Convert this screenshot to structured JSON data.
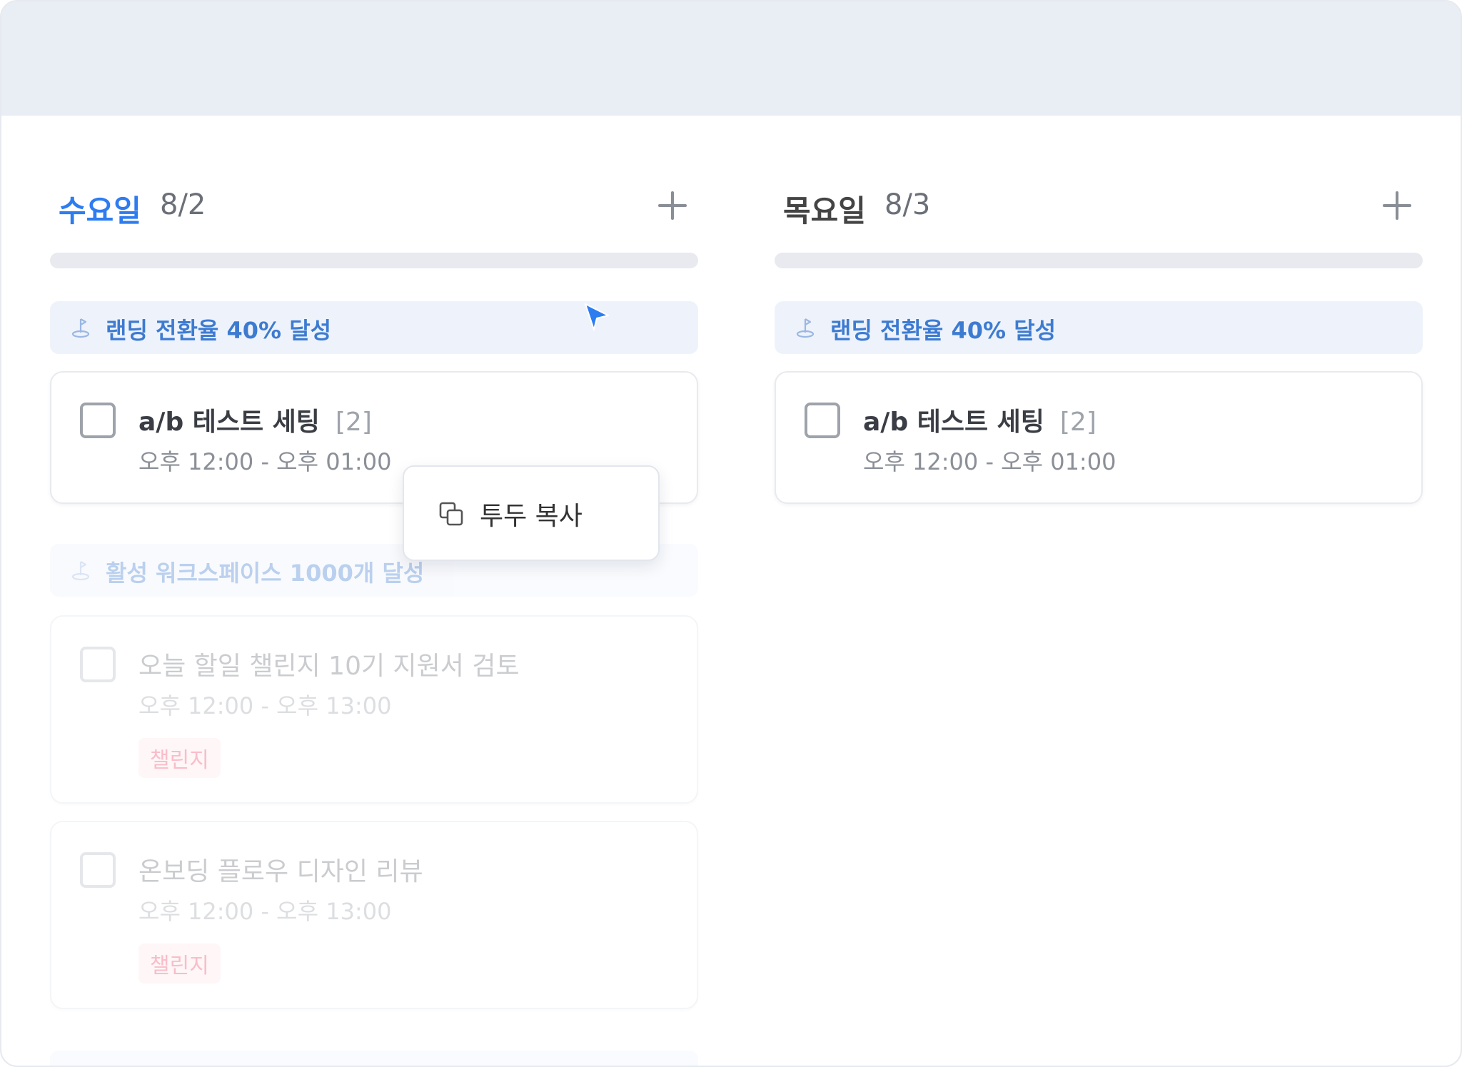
{
  "columns": [
    {
      "day": "수요일",
      "date": "8/2",
      "goals": [
        {
          "label": "랜딩 전환율 40% 달성"
        },
        {
          "label": "활성 워크스페이스 1000개 달성"
        }
      ],
      "tasks": [
        {
          "title": "a/b 테스트 세팅",
          "count": "[2]",
          "time": "오후 12:00 - 오후 01:00"
        },
        {
          "title": "오늘 할일 챌린지 10기 지원서 검토",
          "time": "오후 12:00 - 오후 13:00",
          "tag": "챌린지"
        },
        {
          "title": "온보딩 플로우 디자인 리뷰",
          "time": "오후 12:00 - 오후 13:00",
          "tag": "챌린지"
        }
      ]
    },
    {
      "day": "목요일",
      "date": "8/3",
      "goals": [
        {
          "label": "랜딩 전환율 40% 달성"
        }
      ],
      "tasks": [
        {
          "title": "a/b 테스트 세팅",
          "count": "[2]",
          "time": "오후 12:00 - 오후 01:00"
        }
      ]
    }
  ],
  "context_menu": {
    "items": [
      {
        "label": "투두 복사",
        "icon": "copy-icon"
      }
    ]
  },
  "colors": {
    "accent": "#2d7cf0",
    "goal_text": "#3d7bd1",
    "goal_bg": "#eef3fb",
    "tag_text": "#f26f8b",
    "tag_bg": "#fdecef",
    "top_band": "#e9edf4"
  }
}
